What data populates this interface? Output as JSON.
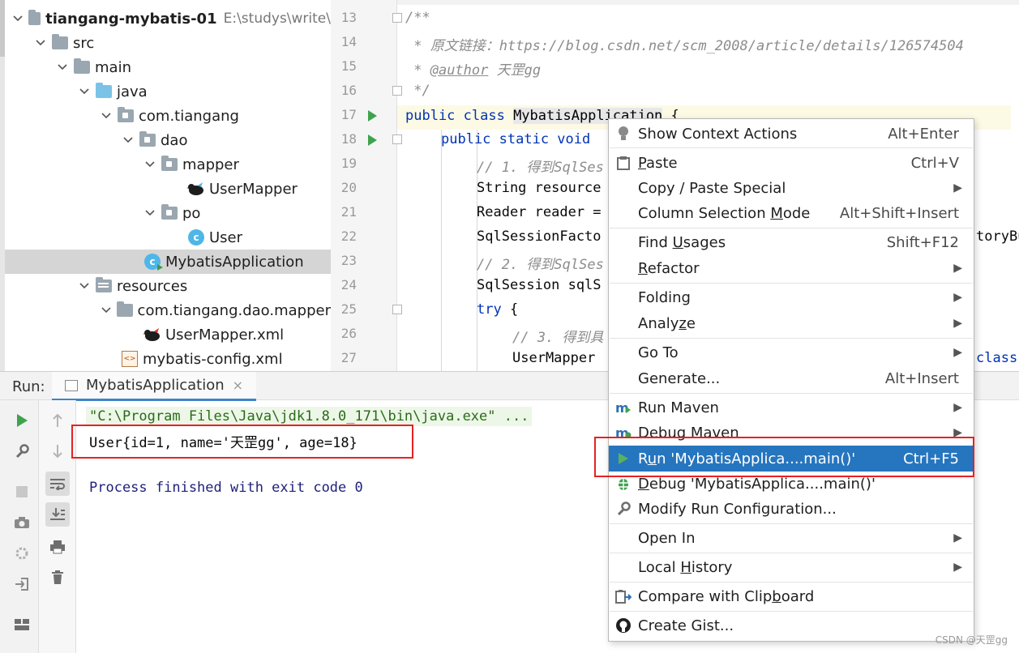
{
  "tree": {
    "project_name": "tiangang-mybatis-01",
    "project_path": "E:\\studys\\write\\",
    "nodes": [
      {
        "label": "src"
      },
      {
        "label": "main"
      },
      {
        "label": "java"
      },
      {
        "label": "com.tiangang"
      },
      {
        "label": "dao"
      },
      {
        "label": "mapper"
      },
      {
        "label": "UserMapper"
      },
      {
        "label": "po"
      },
      {
        "label": "User"
      },
      {
        "label": "MybatisApplication"
      },
      {
        "label": "resources"
      },
      {
        "label": "com.tiangang.dao.mapper"
      },
      {
        "label": "UserMapper.xml"
      },
      {
        "label": "mybatis-config.xml"
      }
    ]
  },
  "editor": {
    "line_numbers": [
      "13",
      "14",
      "15",
      "16",
      "17",
      "18",
      "19",
      "20",
      "21",
      "22",
      "23",
      "24",
      "25",
      "26",
      "27"
    ],
    "lines": {
      "l13": "/**",
      "l14": " * 原文链接：https://blog.csdn.net/scm_2008/article/details/126574504",
      "l15_prefix": " * ",
      "l15_tag": "@author",
      "l15_rest": " 天罡gg",
      "l16": " */",
      "l17_kw": "public class ",
      "l17_name": "MybatisApplication",
      "l17_rest": " {",
      "l18_kw": "public static void",
      "l19": "// 1. 得到SqlSes",
      "l20": "String resource",
      "l21": "Reader reader =",
      "l22": "SqlSessionFacto",
      "l22_right": "toryBu",
      "l23": "// 2. 得到SqlSes",
      "l24": "SqlSession sqlS",
      "l25_kw": "try",
      "l25_rest": " {",
      "l26": "// 3. 得到具",
      "l27": "UserMapper",
      "l27_right": "class"
    }
  },
  "run_panel": {
    "title": "Run:",
    "tab_label": "MybatisApplication",
    "tab_close": "×",
    "console": {
      "command": "\"C:\\Program Files\\Java\\jdk1.8.0_171\\bin\\java.exe\" ...",
      "output": "User{id=1, name='天罡gg', age=18}",
      "finished": "Process finished with exit code 0"
    }
  },
  "context_menu": {
    "items": {
      "show_context_actions": {
        "label": "Show Context Actions",
        "shortcut": "Alt+Enter"
      },
      "paste": {
        "label_u": "P",
        "label_rest": "aste",
        "shortcut": "Ctrl+V"
      },
      "copy_paste_special": {
        "label": "Copy / Paste Special"
      },
      "column_selection_mode": {
        "label_pre": "Column Selection ",
        "label_u": "M",
        "label_rest": "ode",
        "shortcut": "Alt+Shift+Insert"
      },
      "find_usages": {
        "label_pre": "Find ",
        "label_u": "U",
        "label_rest": "sages",
        "shortcut": "Shift+F12"
      },
      "refactor": {
        "label_u": "R",
        "label_rest": "efactor"
      },
      "folding": {
        "label": "Folding"
      },
      "analyze": {
        "label_pre": "Analy",
        "label_u": "z",
        "label_rest": "e"
      },
      "go_to": {
        "label": "Go To"
      },
      "generate": {
        "label": "Generate...",
        "shortcut": "Alt+Insert"
      },
      "run_maven": {
        "label": "Run Maven"
      },
      "debug_maven": {
        "label": "Debug Maven"
      },
      "run_main": {
        "label_pre": "R",
        "label_u": "u",
        "label_rest": "n 'MybatisApplica....main()'",
        "shortcut": "Ctrl+F5"
      },
      "debug_main": {
        "label_u": "D",
        "label_rest": "ebug 'MybatisApplica....main()'"
      },
      "modify_run_config": {
        "label": "Modify Run Configuration..."
      },
      "open_in": {
        "label": "Open In"
      },
      "local_history": {
        "label_pre": "Local ",
        "label_u": "H",
        "label_rest": "istory"
      },
      "compare_clipboard": {
        "label_pre": "Compare with Clip",
        "label_u": "b",
        "label_rest": "oard"
      },
      "create_gist": {
        "label": "Create Gist..."
      }
    },
    "highlight_color": "#2675bf"
  },
  "watermark": "CSDN @天罡gg",
  "colors": {
    "run_green": "#3fa34d",
    "annotation_red": "#e52222",
    "keyword_blue": "#0033b3"
  }
}
